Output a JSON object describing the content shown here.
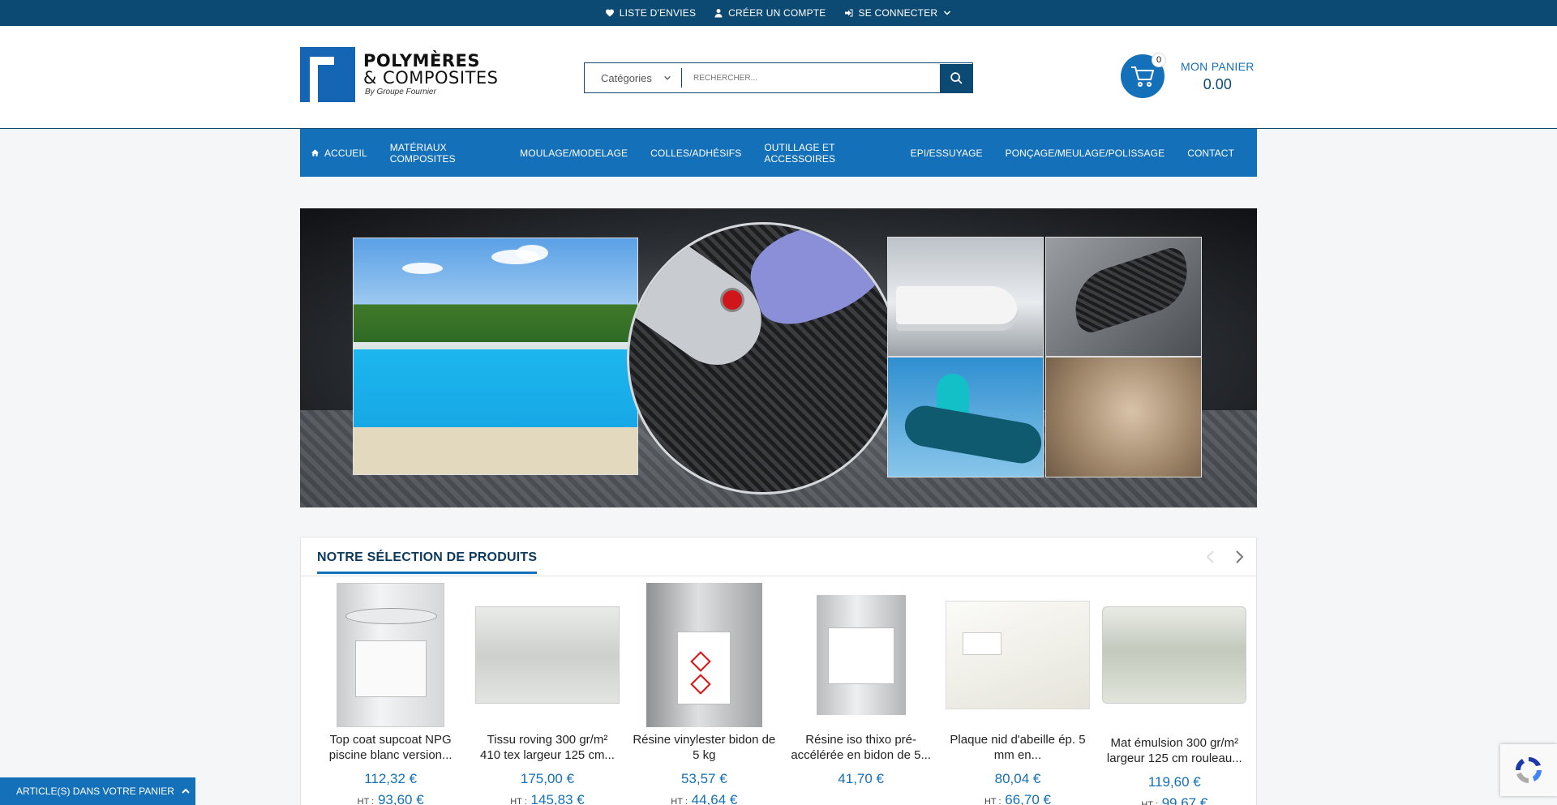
{
  "topbar": {
    "wishlist": "LISTE D'ENVIES",
    "create_account": "CRÉER UN COMPTE",
    "login": "SE CONNECTER"
  },
  "logo": {
    "line1": "POLYMÈRES",
    "line2": "& COMPOSITES",
    "line3": "By Groupe Fournier",
    "brand_color": "#1565b5"
  },
  "search": {
    "category_label": "Catégories",
    "placeholder": "RECHERCHER..."
  },
  "cart": {
    "count": "0",
    "label": "MON PANIER",
    "total": "0.00"
  },
  "nav": {
    "items": [
      {
        "label": "ACCUEIL",
        "icon": "home-icon"
      },
      {
        "label": "MATÉRIAUX COMPOSITES"
      },
      {
        "label": "MOULAGE/MODELAGE"
      },
      {
        "label": "COLLES/ADHÉSIFS"
      },
      {
        "label": "OUTILLAGE ET ACCESSOIRES"
      },
      {
        "label": "EPI/ESSUYAGE"
      },
      {
        "label": "PONÇAGE/MEULAGE/POLISSAGE"
      },
      {
        "label": "CONTACT"
      }
    ]
  },
  "selection": {
    "title": "NOTRE SÉLECTION DE PRODUITS",
    "ht_label": "HT :",
    "products": [
      {
        "name": "Top coat supcoat NPG piscine blanc version...",
        "price": "112,32 €",
        "ht": "93,60 €"
      },
      {
        "name": "Tissu roving 300 gr/m² 410 tex largeur 125 cm...",
        "price": "175,00 €",
        "ht": "145,83 €"
      },
      {
        "name": "Résine vinylester bidon de 5 kg",
        "price": "53,57 €",
        "ht": "44,64 €"
      },
      {
        "name": "Résine iso thixo pré-accélérée en bidon de 5...",
        "price": "41,70 €",
        "ht": ""
      },
      {
        "name": "Plaque nid d'abeille ép. 5 mm en...",
        "price": "80,04 €",
        "ht": "66,70 €"
      },
      {
        "name": "Mat émulsion 300 gr/m² largeur 125 cm rouleau...",
        "price": "119,60 €",
        "ht": "99,67 €"
      }
    ]
  },
  "bottom_bar": {
    "label": "ARTICLE(S) DANS VOTRE PANIER"
  },
  "colors": {
    "topbar": "#0c4a74",
    "accent": "#1470b8"
  }
}
